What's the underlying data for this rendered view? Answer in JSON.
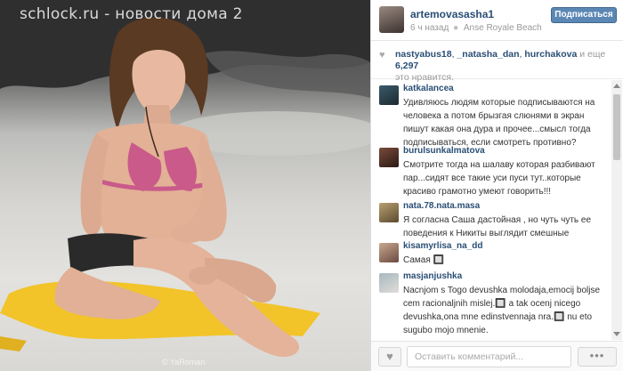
{
  "photo": {
    "watermark": "schlock.ru - новости дома 2",
    "credit": "© YaRoman"
  },
  "post": {
    "username": "artemovasasha1",
    "time_ago": "6 ч назад",
    "location": "Anse Royale Beach",
    "follow_label": "Подписаться"
  },
  "likes": {
    "users": [
      "nastyabus18",
      "_natasha_dan",
      "hurchakova"
    ],
    "and_more": "и еще",
    "count": "6,297",
    "suffix": "это нравится."
  },
  "comments": [
    {
      "user": "katkalancea",
      "text": "Удивляюсь людям которые подписываются на человека а потом брызгая слюнями в экран пишут какая она дура и прочее...смысл тогда подписываться, если смотреть противно?"
    },
    {
      "user": "burulsunkalmatova",
      "text": "Смотрите тогда на шалаву которая разбивают пар...сидят все такие уси пуси тут..которые красиво грамотно умеют говорить!!!"
    },
    {
      "user": "nata.78.nata.masa",
      "text": "Я согласна Саша дастойная , но чуть чуть ее поведения к Никиты выглядит смешные"
    },
    {
      "user": "kisamyrlisa_na_dd",
      "text": "Самая 🔲"
    },
    {
      "user": "masjanjushka",
      "text": "Nacnjom s Togo devushka molodaja,emocij boljse cem racionaljnih mislej.🔲 a tak ocenj nicego devushka,ona mne edinstvennaja nra.🔲 nu eto sugubo mojo mnenie."
    }
  ],
  "footer": {
    "comment_placeholder": "Оставить комментарий...",
    "more_label": "•••"
  },
  "icons": {
    "heart": "heart-icon",
    "location": "location-pin-icon",
    "more": "more-dots-icon"
  },
  "colors": {
    "username": "#2a4e74",
    "follow_button": "#5b87b4",
    "towel": "#f2c42a"
  }
}
